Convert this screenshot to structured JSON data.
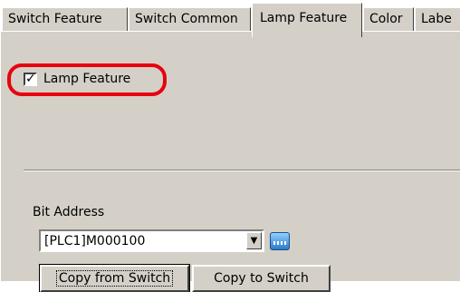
{
  "tabs": [
    {
      "label": "Switch Feature",
      "active": false
    },
    {
      "label": "Switch Common",
      "active": false
    },
    {
      "label": "Lamp Feature",
      "active": true
    },
    {
      "label": "Color",
      "active": false
    },
    {
      "label": "Labe",
      "active": false
    }
  ],
  "lamp_feature": {
    "label": "Lamp Feature",
    "checked": true,
    "check_glyph": "✓"
  },
  "bit_address": {
    "label": "Bit Address",
    "value": "[PLC1]M000100",
    "arrow": "▼"
  },
  "buttons": {
    "copy_from": "Copy from Switch",
    "copy_to": "Copy to Switch"
  },
  "colors": {
    "panel": "#d4d0c8",
    "highlight": "#e8000f"
  },
  "icons": {
    "dropdown": "chevron-down-icon",
    "browse": "address-input-icon"
  }
}
